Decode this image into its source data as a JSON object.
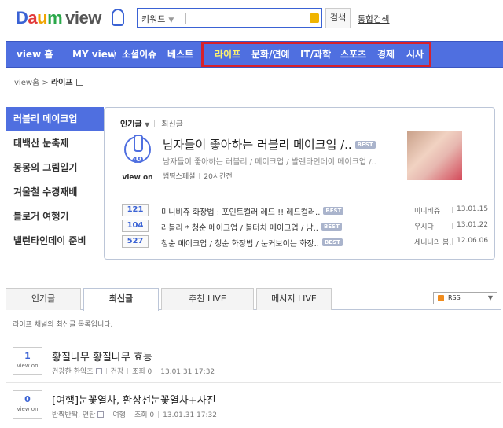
{
  "header": {
    "logo_d": "D",
    "logo_a": "a",
    "logo_u": "u",
    "logo_m": "m",
    "logo_view": "view",
    "search_select": "키워드",
    "search_placeholder": "",
    "search_button": "검색",
    "total_search": "통합검색"
  },
  "nav": {
    "items": [
      "view 홈",
      "MY view",
      "소셜이슈",
      "베스트",
      "라이프",
      "문화/연예",
      "IT/과학",
      "스포츠",
      "경제",
      "시사"
    ],
    "active_index": 4,
    "highlight_color": "#d8212b",
    "bar_color": "#4f6fe0"
  },
  "breadcrumb": {
    "home": "view홈",
    "sep": " > ",
    "current": "라이프"
  },
  "featured": {
    "side_items": [
      "러블리 메이크업",
      "태백산 눈축제",
      "몽몽의 그림일기",
      "겨울철 수경재배",
      "블로거 여행기",
      "밸런타인데이 준비"
    ],
    "tab_popular": "인기글",
    "tab_latest": "최신글",
    "main": {
      "count": "49",
      "viewon_label": "view on",
      "title": "남자들이 좋아하는 러블리 메이크업 /..",
      "badge": "BEST",
      "desc": "남자들이 좋아하는 러블리 / 메이크업 / 발렌타인데이 메이크업 /..",
      "author": "썸띵스페셜",
      "time": "20시간전"
    },
    "rows": [
      {
        "count": "121",
        "title": "미니비쥬 화장법 : 포인트컬러 레드 !! 레드컬러..",
        "badge": "BEST",
        "author": "미니비쥬",
        "date": "13.01.15"
      },
      {
        "count": "104",
        "title": "러블리 * 청순 메이크업 / 볼터치 메이크업 / 남..",
        "badge": "BEST",
        "author": "우시다",
        "date": "13.01.22"
      },
      {
        "count": "527",
        "title": "청순 메이크업 / 청순 화장법 / 눈커보이는 화장..",
        "badge": "BEST",
        "author": "세니니의 봄,",
        "date": "12.06.06"
      }
    ]
  },
  "lower_tabs": {
    "items": [
      "인기글",
      "최신글",
      "추천 LIVE",
      "메시지 LIVE"
    ],
    "active_index": 1,
    "rss_label": "RSS"
  },
  "list": {
    "desc": "라이프 채널의 최신글 목록입니다.",
    "posts": [
      {
        "count": "1",
        "count_label": "view on",
        "title": "황칠나무 황칠나무 효능",
        "author": "건강한 한약초",
        "category": "건강",
        "views": "조회 0",
        "date": "13.01.31 17:32"
      },
      {
        "count": "0",
        "count_label": "view on",
        "title": "[여행]눈꽃열차, 환상선눈꽃열차+사진",
        "author": "반짝반짝, 연탄",
        "category": "여행",
        "views": "조회 0",
        "date": "13.01.31 17:32"
      }
    ]
  }
}
